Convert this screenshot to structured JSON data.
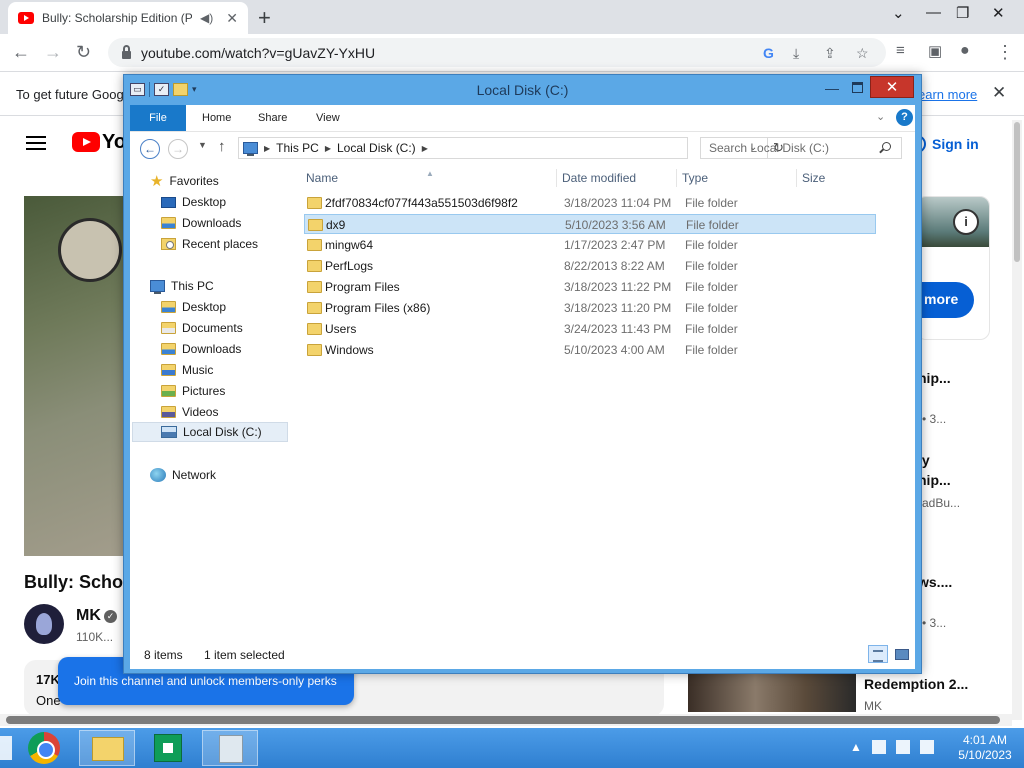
{
  "browser": {
    "tab_title": "Bully: Scholarship Edition (PC",
    "tab_audio_icon": "speaker-icon",
    "new_tab_label": "+",
    "url": "youtube.com/watch?v=gUavZY-YxHU",
    "infobar_text": "To get future Goog",
    "infobar_link": "earn more"
  },
  "youtube": {
    "title_partial": "Bully: Schola",
    "channel": "MK",
    "subs": "110K...",
    "views": "17K",
    "desc": "One",
    "join_text": "Join this channel and unlock members-only perks",
    "signin": "Sign in",
    "ad_more": "more",
    "recs": [
      {
        "title": "hip...",
        "meta": "• 3..."
      },
      {
        "title": "ly",
        "meta": ""
      },
      {
        "title": "hip...",
        "meta": "adBu..."
      },
      {
        "title": "ws....",
        "meta": "• 3..."
      }
    ],
    "rec_bottom_title": "Redemption 2...",
    "rec_bottom_channel": "MK"
  },
  "explorer": {
    "title": "Local Disk (C:)",
    "ribbon_tabs": [
      "File",
      "Home",
      "Share",
      "View"
    ],
    "breadcrumb": [
      "This PC",
      "Local Disk (C:)"
    ],
    "search_placeholder": "Search Local Disk (C:)",
    "columns": [
      "Name",
      "Date modified",
      "Type",
      "Size"
    ],
    "nav": {
      "favorites": "Favorites",
      "fav_items": [
        "Desktop",
        "Downloads",
        "Recent places"
      ],
      "this_pc": "This PC",
      "pc_items": [
        "Desktop",
        "Documents",
        "Downloads",
        "Music",
        "Pictures",
        "Videos",
        "Local Disk (C:)"
      ],
      "network": "Network"
    },
    "files": [
      {
        "name": "2fdf70834cf077f443a551503d6f98f2",
        "date": "3/18/2023 11:04 PM",
        "type": "File folder"
      },
      {
        "name": "dx9",
        "date": "5/10/2023 3:56 AM",
        "type": "File folder"
      },
      {
        "name": "mingw64",
        "date": "1/17/2023 2:47 PM",
        "type": "File folder"
      },
      {
        "name": "PerfLogs",
        "date": "8/22/2013 8:22 AM",
        "type": "File folder"
      },
      {
        "name": "Program Files",
        "date": "3/18/2023 11:22 PM",
        "type": "File folder"
      },
      {
        "name": "Program Files (x86)",
        "date": "3/18/2023 11:20 PM",
        "type": "File folder"
      },
      {
        "name": "Users",
        "date": "3/24/2023 11:43 PM",
        "type": "File folder"
      },
      {
        "name": "Windows",
        "date": "5/10/2023 4:00 AM",
        "type": "File folder"
      }
    ],
    "status_count": "8 items",
    "status_selected": "1 item selected"
  },
  "taskbar": {
    "time": "4:01 AM",
    "date": "5/10/2023"
  },
  "colors": {
    "accent": "#1979ca",
    "selection": "#cce4f7",
    "titlebar": "#5ba8e6"
  }
}
